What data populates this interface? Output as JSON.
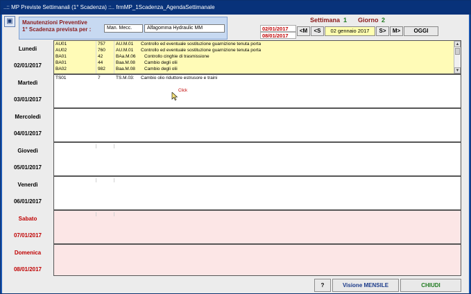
{
  "window": {
    "title": "..:: MP Previste Settimanali (1° Scadenza) ::..   frmMP_1Scadenza_AgendaSettimanale"
  },
  "header": {
    "title_line1": "Manutenzioni Preventive",
    "title_line2": "1° Scadenza prevista per :",
    "field_type": "Man. Mecc.",
    "field_machine": "Alfagomma Hydraulic MM"
  },
  "nav": {
    "settimana_label": "Settimana",
    "settimana_value": "1",
    "giorno_label": "Giorno",
    "giorno_value": "2",
    "range_start": "02/01/2017",
    "range_end": "08/01/2017",
    "prev_month": "<M",
    "prev_week": "<S",
    "current_date": "02 gennaio 2017",
    "next_week": "S>",
    "next_month": "M>",
    "today": "OGGI"
  },
  "days": [
    {
      "name": "Lunedi",
      "date": "02/01/2017",
      "rows": [
        {
          "code": "AU01",
          "qty": "757",
          "ref": "AU.M.01",
          "desc": "Controllo ed eventuale sostituzione guarnizione tenuta porta"
        },
        {
          "code": "AU02",
          "qty": "760",
          "ref": "AU.M.01",
          "desc": "Controllo ed eventuale sostituzione guarnizione tenuta porta"
        },
        {
          "code": "BA01",
          "qty": "42",
          "ref": "BAa.M.06",
          "desc": "Controllo cinghie di trasmissione"
        },
        {
          "code": "BA01",
          "qty": "44",
          "ref": "Baa.M.08",
          "desc": "Cambio degli olii"
        },
        {
          "code": "BA02",
          "qty": "982",
          "ref": "Baa.M.08",
          "desc": "Cambio degli olii"
        }
      ]
    },
    {
      "name": "Martedì",
      "date": "03/01/2017",
      "rows": [
        {
          "code": "TS01",
          "qty": "7",
          "ref": "TS.M.03:",
          "desc": "Cambio olio riduttore estrusore e traini"
        }
      ]
    },
    {
      "name": "Mercoledì",
      "date": "04/01/2017",
      "rows": []
    },
    {
      "name": "Giovedì",
      "date": "05/01/2017",
      "rows": []
    },
    {
      "name": "Venerdì",
      "date": "06/01/2017",
      "rows": []
    },
    {
      "name": "Sabato",
      "date": "07/01/2017",
      "rows": []
    },
    {
      "name": "Domenica",
      "date": "08/01/2017",
      "rows": []
    }
  ],
  "cursor_tooltip": "Click",
  "footer": {
    "help_label": "?",
    "monthly_label": "Visione MENSILE",
    "close_label": "CHIUDI"
  },
  "colors": {
    "accent_red": "#c00000",
    "accent_green": "#1e7a1e",
    "weekend_bg": "#fce6e6",
    "selected_bg": "#fffbb7"
  }
}
